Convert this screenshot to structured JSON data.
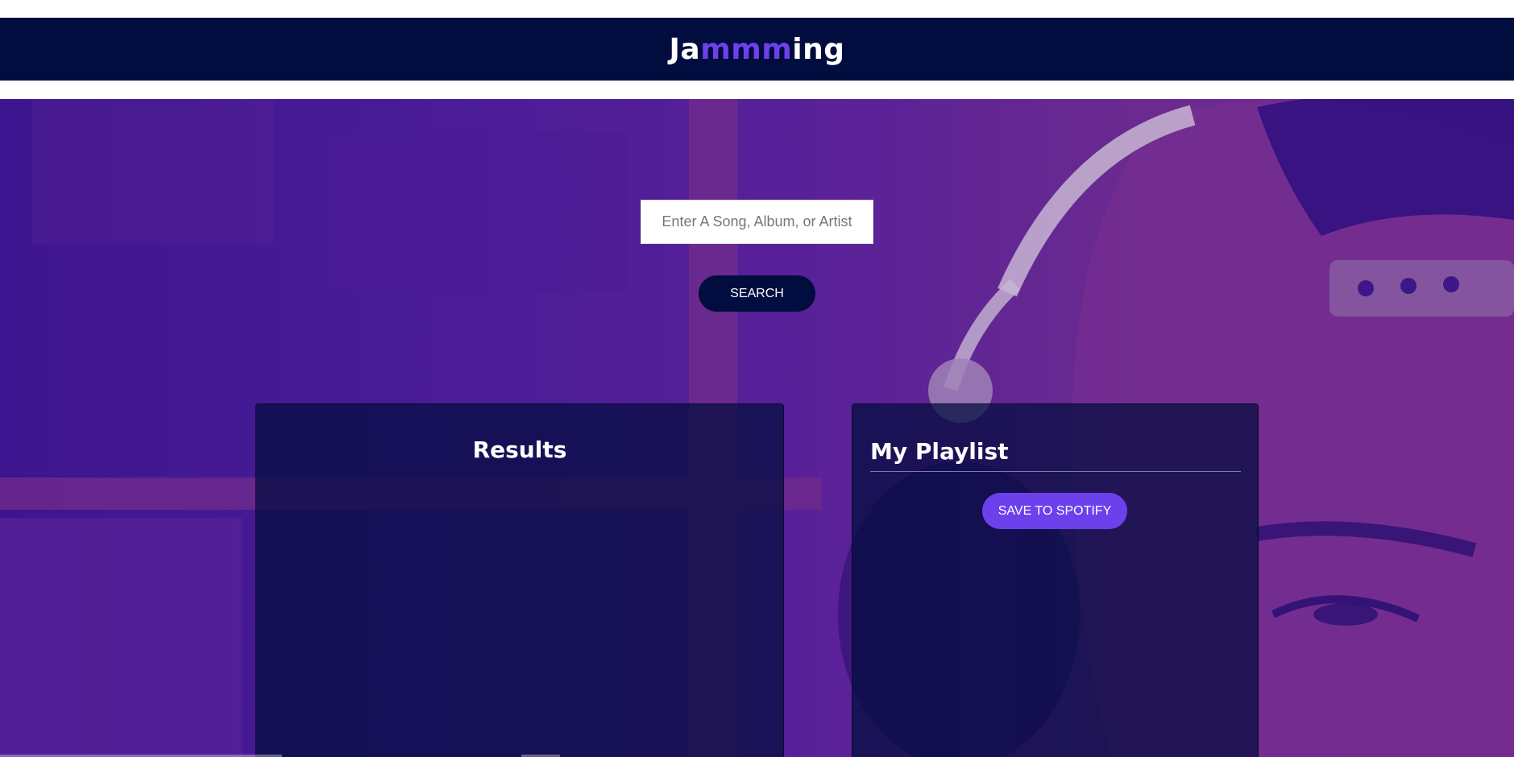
{
  "header": {
    "logo_prefix": "Ja",
    "logo_accent": "mmm",
    "logo_suffix": "ing"
  },
  "search": {
    "placeholder": "Enter A Song, Album, or Artist",
    "button_label": "SEARCH"
  },
  "results": {
    "title": "Results"
  },
  "playlist": {
    "title": "My Playlist",
    "save_label": "SAVE TO SPOTIFY"
  },
  "colors": {
    "header_bg": "#010c3f",
    "accent": "#6c41ec",
    "hero_purple": "#4a1c97",
    "panel_bg": "#010c3f"
  }
}
